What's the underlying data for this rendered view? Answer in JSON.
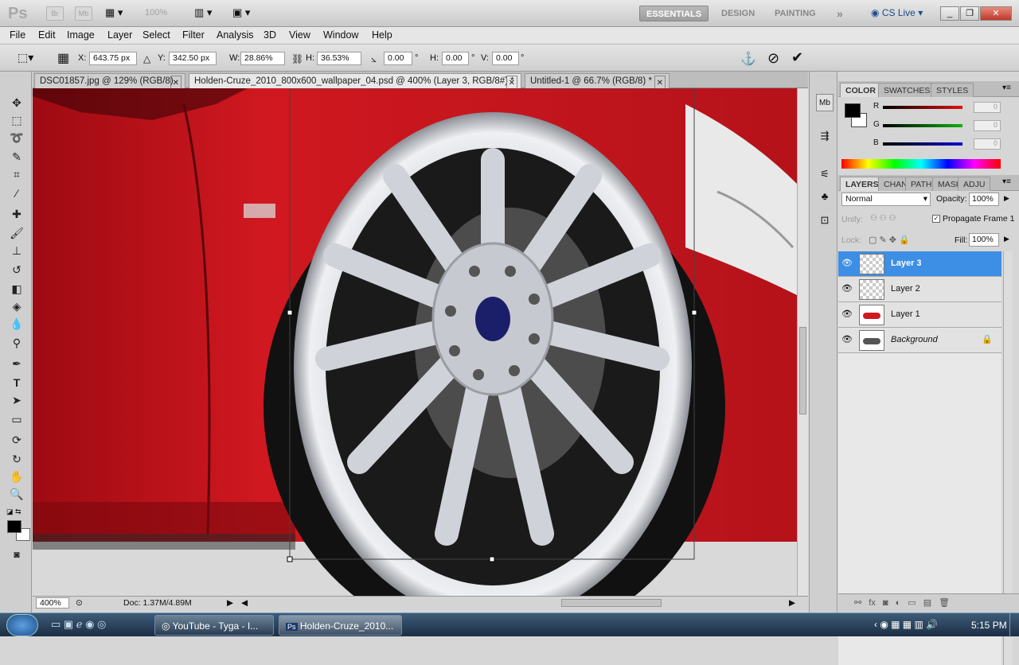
{
  "app": {
    "logo": "Ps",
    "bridge_label": "Br",
    "minibridge_label": "Mb",
    "zoom_display": "100%",
    "workspaces": [
      "ESSENTIALS",
      "DESIGN",
      "PAINTING"
    ],
    "more_label": "»",
    "cs_live": "CS Live"
  },
  "menu": [
    "File",
    "Edit",
    "Image",
    "Layer",
    "Select",
    "Filter",
    "Analysis",
    "3D",
    "View",
    "Window",
    "Help"
  ],
  "options": {
    "x_label": "X:",
    "x_value": "643.75 px",
    "y_label": "Y:",
    "y_value": "342.50 px",
    "w_label": "W:",
    "w_value": "28.86%",
    "h_label": "H:",
    "h_value": "36.53%",
    "rot_value": "0.00",
    "rot_unit": "°",
    "hs_label": "H:",
    "hs_value": "0.00",
    "hs_unit": "°",
    "vs_label": "V:",
    "vs_value": "0.00"
  },
  "tabs": [
    {
      "label": "DSC01857.jpg @ 129% (RGB/8)"
    },
    {
      "label": "Holden-Cruze_2010_800x600_wallpaper_04.psd @ 400% (Layer 3, RGB/8#) *"
    },
    {
      "label": "Untitled-1 @ 66.7% (RGB/8) *"
    }
  ],
  "status": {
    "zoom": "400%",
    "doc": "Doc: 1.37M/4.89M"
  },
  "color_panel": {
    "tabs": [
      "COLOR",
      "SWATCHES",
      "STYLES"
    ],
    "channels": [
      {
        "label": "R",
        "value": "0",
        "color": "#e01010"
      },
      {
        "label": "G",
        "value": "0",
        "color": "#10b010"
      },
      {
        "label": "B",
        "value": "0",
        "color": "#1010d0"
      }
    ]
  },
  "layers_panel": {
    "tabs": [
      "LAYERS",
      "CHAN",
      "PATH",
      "MASK",
      "ADJU"
    ],
    "blend_mode": "Normal",
    "opacity_label": "Opacity:",
    "opacity": "100%",
    "unify_label": "Unify:",
    "propagate_label": "Propagate Frame 1",
    "lock_label": "Lock:",
    "fill_label": "Fill:",
    "fill": "100%",
    "layers": [
      {
        "name": "Layer 3",
        "selected": true
      },
      {
        "name": "Layer 2",
        "selected": false
      },
      {
        "name": "Layer 1",
        "selected": false
      },
      {
        "name": "Background",
        "selected": false
      }
    ]
  },
  "taskbar": {
    "items": [
      "YouTube - Tyga - I...",
      "Holden-Cruze_2010..."
    ],
    "time": "5:15 PM"
  }
}
